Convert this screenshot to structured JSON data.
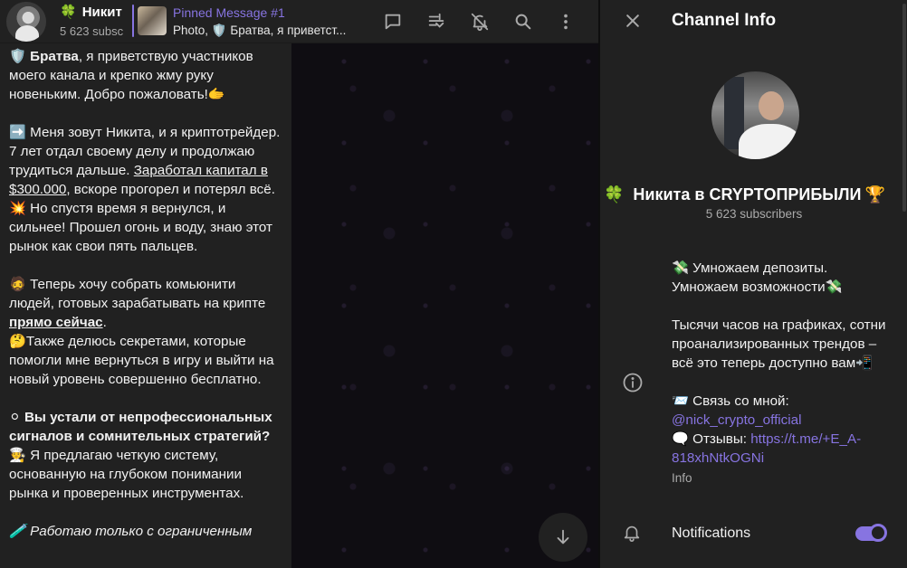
{
  "header": {
    "title_emoji": "🍀",
    "title": "Никит",
    "subtitle": "5 623 subsc",
    "pinned_title": "Pinned Message #1",
    "pinned_preview": "Photo, 🛡️ Братва, я приветст..."
  },
  "message": {
    "p1_emoji": "🛡️",
    "p1_bold": "Братва",
    "p1_rest": ", я приветствую участников моего канала и крепко жму руку новеньким. Добро пожаловать!🫱",
    "p2_pre": "➡️ Меня зовут Никита, и я криптотрейдер. 7 лет отдал своему делу и продолжаю трудиться дальше. ",
    "p2_link": "Заработал капитал в $300.000",
    "p2_post": ", вскоре прогорел и потерял всё. 💥 Но спустя время я вернулся, и сильнее! Прошел огонь и воду, знаю этот рынок как свои пять пальцев.",
    "p3_pre": "🧔 Теперь хочу собрать комьюнити людей, готовых зарабатывать на крипте ",
    "p3_bold_link": "прямо сейчас",
    "p3_post": ".",
    "p4": "🤔Также делюсь секретами, которые помогли мне вернуться в игру и выйти на новый уровень совершенно бесплатно.",
    "p5_bold": "⚪ Вы устали от непрофессиональных сигналов и сомнительных стратегий?",
    "p5_rest": "🧑‍🍳 Я предлагаю четкую систему, основанную на глубоком понимании рынка и проверенных инструментах.",
    "p6": "🧪 Работаю только с ограниченным"
  },
  "info": {
    "title": "Channel Info",
    "name_emoji_left": "🍀",
    "name": "Никита в CRYPTOПРИБЫЛИ",
    "name_emoji_right": "🏆",
    "subscribers": "5 623 subscribers",
    "desc_block1": "💸 Умножаем депозиты.\nУмножаем возможности💸",
    "desc_block2": "Тысячи часов на графиках, сотни проанализированных трендов – всё это теперь доступно вам📲",
    "contact_label": "📨  Связь со мной:",
    "contact_link": "@nick_crypto_official",
    "reviews_label": "🗨️  Отзывы: ",
    "reviews_link": "https://t.me/+E_A-818xhNtkOGNi",
    "desc_caption": "Info",
    "notifications_label": "Notifications",
    "notifications_on": true
  },
  "colors": {
    "accent": "#8774e1",
    "panel": "#212121",
    "muted": "#aaaaaa"
  },
  "icons": [
    "discussion-icon",
    "polls-icon",
    "mute-icon",
    "search-icon",
    "more-icon",
    "close-icon",
    "info-icon",
    "bell-icon",
    "arrow-down-icon"
  ]
}
